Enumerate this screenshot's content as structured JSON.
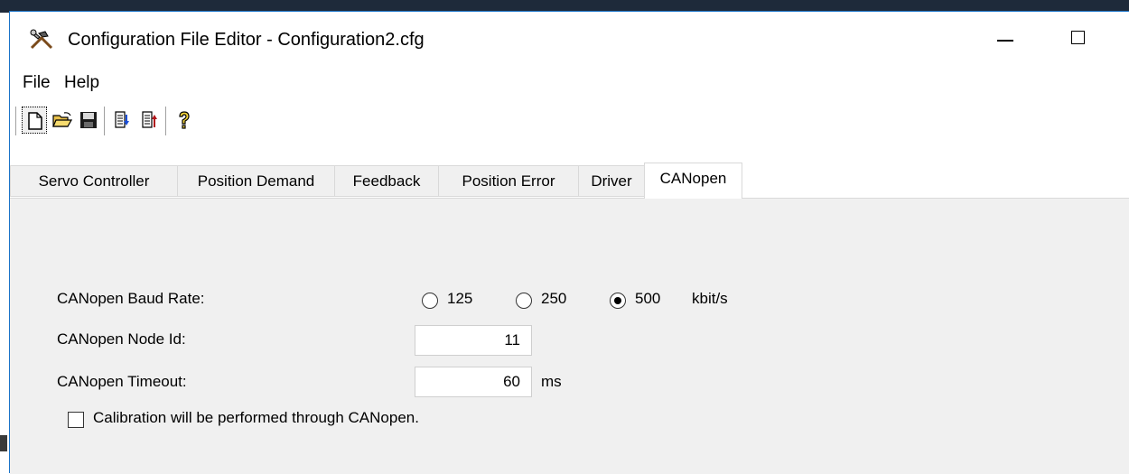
{
  "window": {
    "title": "Configuration File Editor - Configuration2.cfg",
    "icons": [
      "tools-icon",
      "minimize-icon",
      "maximize-icon"
    ]
  },
  "menu": {
    "items": [
      "File",
      "Help"
    ]
  },
  "toolbar": {
    "buttons": [
      "new-file-icon",
      "open-folder-icon",
      "save-icon",
      "copy-config-icon",
      "paste-config-icon",
      "help-icon"
    ]
  },
  "tabs": [
    {
      "label": "Servo Controller"
    },
    {
      "label": "Position Demand"
    },
    {
      "label": "Feedback"
    },
    {
      "label": "Position Error"
    },
    {
      "label": "Driver"
    },
    {
      "label": "CANopen"
    }
  ],
  "active_tab": "CANopen",
  "canopen": {
    "baud_label": "CANopen Baud Rate:",
    "baud_options": [
      "125",
      "250",
      "500"
    ],
    "baud_selected": "500",
    "baud_unit": "kbit/s",
    "node_label": "CANopen Node Id:",
    "node_value": "11",
    "timeout_label": "CANopen Timeout:",
    "timeout_value": "60",
    "timeout_unit": "ms",
    "calibration_label": "Calibration will be performed through CANopen.",
    "calibration_checked": false
  },
  "colors": {
    "accent": "#1a73c8",
    "panel": "#f0f0f0",
    "tab_border": "#d9d9d9"
  }
}
